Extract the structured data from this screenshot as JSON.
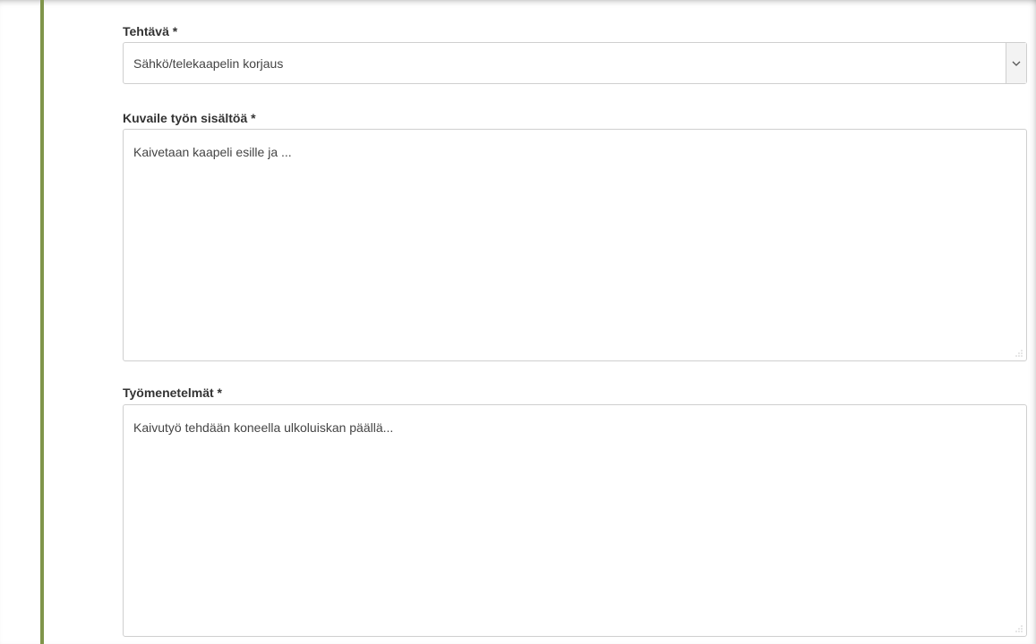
{
  "form": {
    "task": {
      "label": "Tehtävä *",
      "selected_value": "Sähkö/telekaapelin korjaus"
    },
    "work_description": {
      "label": "Kuvaile työn sisältöä *",
      "value": "Kaivetaan kaapeli esille ja ..."
    },
    "work_methods": {
      "label": "Työmenetelmät *",
      "value": "Kaivutyö tehdään koneella ulkoluiskan päällä..."
    }
  },
  "colors": {
    "accent_bar": "#7f954a",
    "border": "#cfcfcf",
    "label_text": "#333333",
    "field_text": "#444444"
  },
  "icons": {
    "select_arrow": "chevron-down-icon",
    "resize_grip": "resize-grip-icon"
  }
}
